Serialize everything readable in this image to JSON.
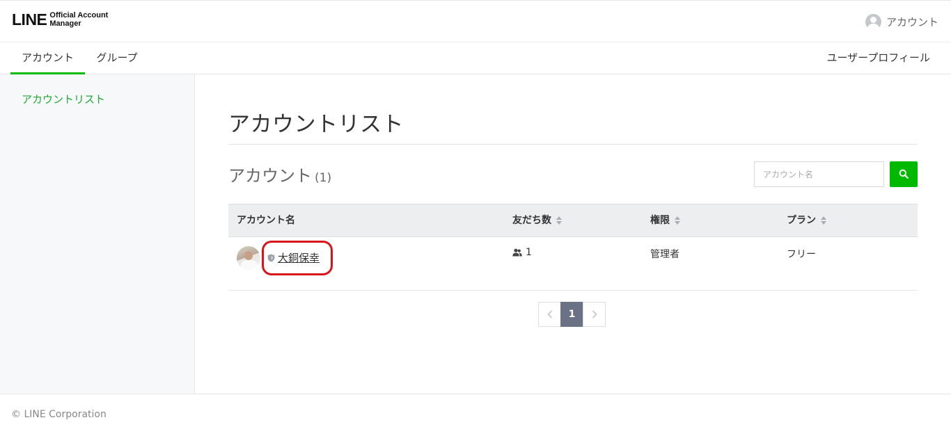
{
  "header": {
    "logo_main": "LINE",
    "logo_sub_1": "Official Account",
    "logo_sub_2": "Manager",
    "account_menu_label": "アカウント"
  },
  "nav": {
    "tabs": [
      {
        "label": "アカウント",
        "active": true
      },
      {
        "label": "グループ",
        "active": false
      }
    ],
    "profile_link": "ユーザープロフィール"
  },
  "sidebar": {
    "items": [
      {
        "label": "アカウントリスト",
        "active": true
      }
    ]
  },
  "main": {
    "page_title": "アカウントリスト",
    "section_title": "アカウント",
    "section_count": "(1)",
    "search": {
      "placeholder": "アカウント名",
      "value": ""
    },
    "table": {
      "headers": [
        "アカウント名",
        "友だち数",
        "権限",
        "プラン"
      ],
      "rows": [
        {
          "name": "大銅保幸",
          "friends": "1",
          "role": "管理者",
          "plan": "フリー"
        }
      ]
    },
    "pagination": {
      "prev": "‹",
      "current": "1",
      "next": "›"
    }
  },
  "footer": {
    "copyright": "© LINE Corporation"
  },
  "colors": {
    "accent_green": "#00b900",
    "link_green": "#1ea833",
    "highlight_red": "#d8141b",
    "pager_active": "#6b7285"
  },
  "icons": [
    "user-avatar-icon",
    "search-icon",
    "sort-icon",
    "shield-icon",
    "friends-icon",
    "chevron-left-icon",
    "chevron-right-icon"
  ]
}
